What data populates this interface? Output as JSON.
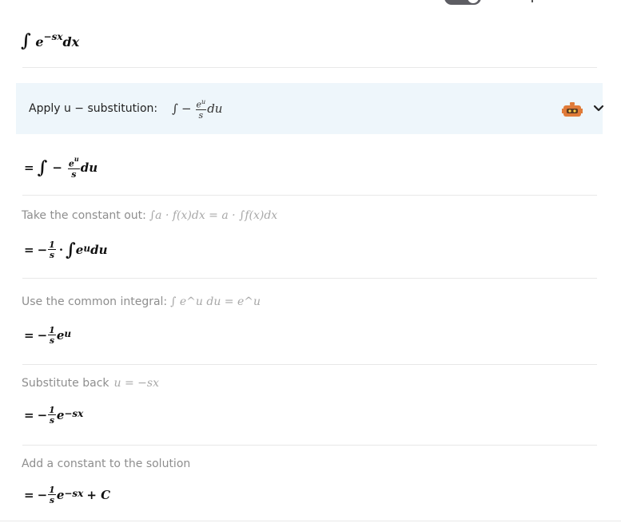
{
  "problem": {
    "expression": "∫e^{-sx}dx",
    "int": "∫",
    "base": "e",
    "exp": "−sx",
    "dx": "dx"
  },
  "steps": [
    {
      "title": "Apply u − substitution:",
      "rule_text": "∫ − e^u/s du",
      "rule": {
        "int": "∫",
        "minus": "−",
        "num": "e^u",
        "den": "s",
        "du": "du"
      },
      "result_text": "=∫ − e^u/s du",
      "result": {
        "eq": "=",
        "int": "∫",
        "minus": "−",
        "num": "e^u",
        "den": "s",
        "du": "du"
      },
      "expanded": true
    },
    {
      "title": "Take the constant out:",
      "rule_text": "∫a · f(x)dx = a · ∫f(x)dx",
      "result_text": "= −1/s · ∫e^u du",
      "result": {
        "eq": "=",
        "minus": "−",
        "num": "1",
        "den": "s",
        "dot": "·",
        "int": "∫",
        "tail": "e",
        "sup": "u",
        "du": "du"
      }
    },
    {
      "title": "Use the common integral:",
      "rule_text": "∫ e^u du = e^u",
      "result_text": "= −1/s e^u",
      "result": {
        "eq": "=",
        "minus": "−",
        "num": "1",
        "den": "s",
        "tail": "e",
        "sup": "u"
      }
    },
    {
      "title": "Substitute back",
      "rule_text": "u = −sx",
      "result_text": "= −1/s e^{−sx}",
      "result": {
        "eq": "=",
        "minus": "−",
        "num": "1",
        "den": "s",
        "tail": "e",
        "sup": "−sx"
      }
    },
    {
      "title": "Add a constant to the solution",
      "rule_text": "",
      "result_text": "= −1/s e^{−sx} + C",
      "result": {
        "eq": "=",
        "minus": "−",
        "num": "1",
        "den": "s",
        "tail": "e",
        "sup": "−sx",
        "plus": "+ C"
      }
    }
  ],
  "icons": {
    "robot": "robot-icon",
    "chevron": "chevron-down-icon"
  },
  "colors": {
    "step_header_bg": "#eef6fb",
    "robot_orange": "#e07b39",
    "caption_gray": "#8e8e8e"
  }
}
